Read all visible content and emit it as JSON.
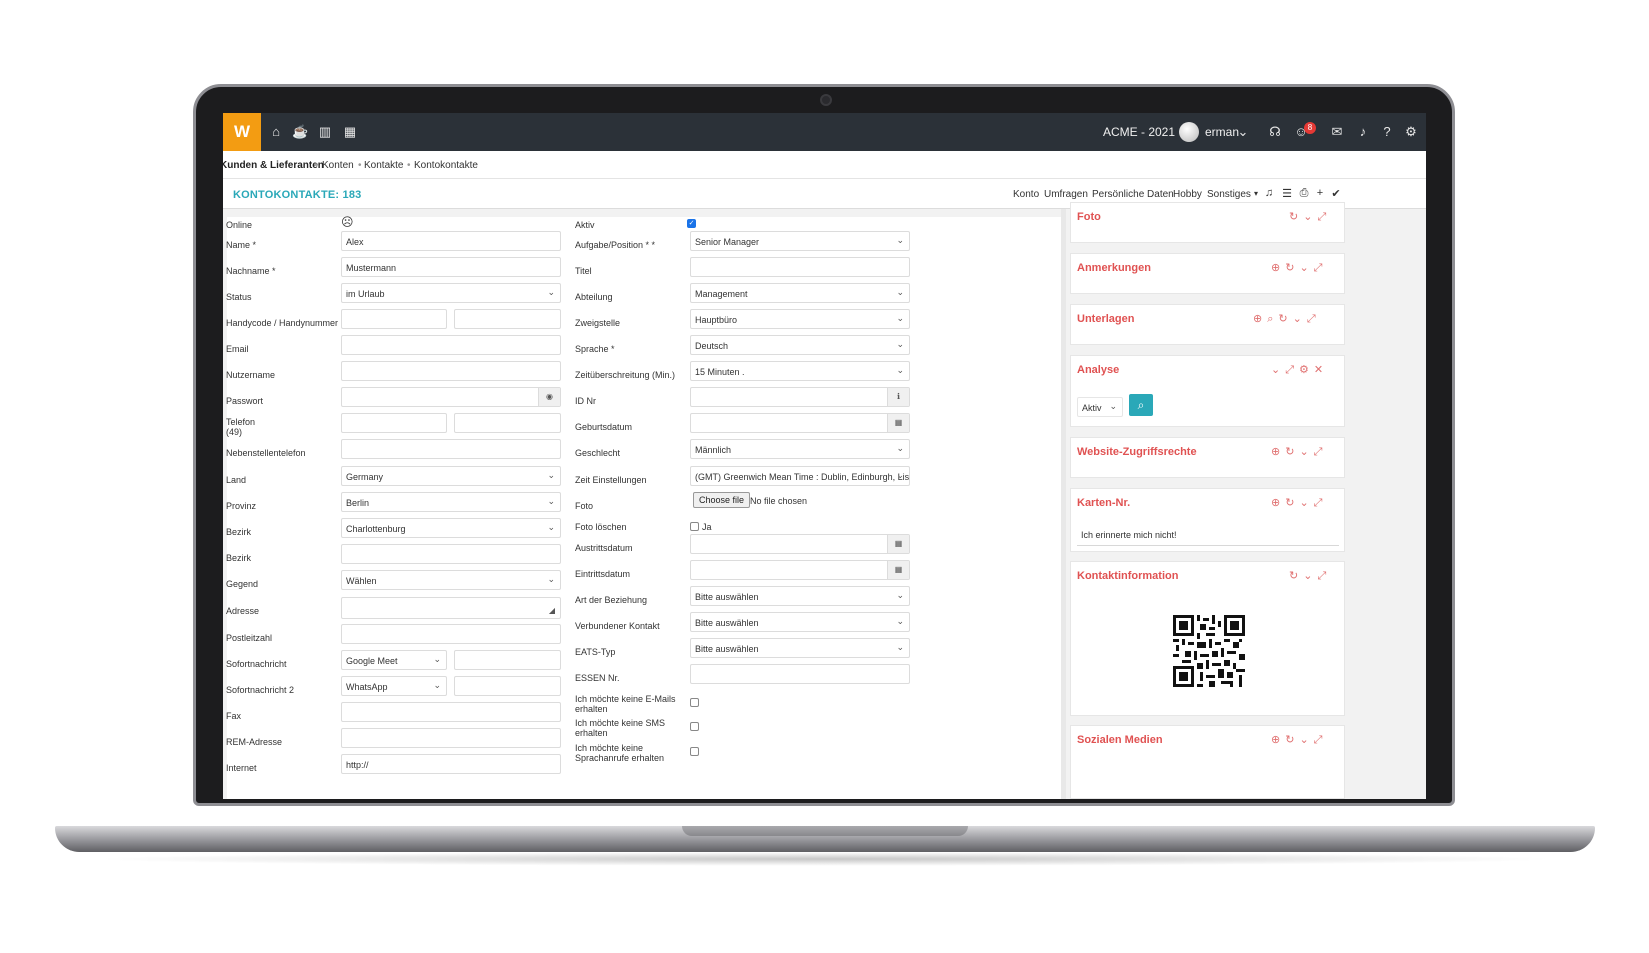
{
  "topbar": {
    "logo": "W",
    "company": "ACME - 2021",
    "user": "erman",
    "notification_count": "8",
    "nav_icons": [
      "home-icon",
      "coffee-icon",
      "chart-icon",
      "calendar-icon"
    ],
    "right_icons": [
      "headset-icon",
      "smile-icon",
      "chat-icon",
      "bell-icon",
      "help-icon",
      "gear-icon"
    ]
  },
  "breadcrumb": [
    "Kunden & Lieferanten",
    "Konten",
    "Kontakte",
    "Kontokontakte"
  ],
  "titlebar": {
    "title": "KONTOKONTAKTE: 183",
    "tabs": [
      "Konto",
      "Umfragen",
      "Persönliche Daten",
      "Hobby",
      "Sonstiges"
    ]
  },
  "form_left": {
    "online_label": "Online",
    "name_label": "Name *",
    "name_value": "Alex",
    "nachname_label": "Nachname *",
    "nachname_value": "Mustermann",
    "status_label": "Status",
    "status_value": "im Urlaub",
    "handy_label": "Handycode / Handynummer",
    "email_label": "Email",
    "nutzername_label": "Nutzername",
    "passwort_label": "Passwort",
    "telefon_label": "Telefon",
    "telefon_code": "(49)",
    "nebenstelle_label": "Nebenstellentelefon",
    "land_label": "Land",
    "land_value": "Germany",
    "provinz_label": "Provinz",
    "provinz_value": "Berlin",
    "bezirk_label": "Bezirk",
    "bezirk_value": "Charlottenburg",
    "bezirk2_label": "Bezirk",
    "gegend_label": "Gegend",
    "gegend_value": "Wählen",
    "adresse_label": "Adresse",
    "plz_label": "Postleitzahl",
    "sofort_label": "Sofortnachricht",
    "sofort_value": "Google Meet",
    "sofort2_label": "Sofortnachricht 2",
    "sofort2_value": "WhatsApp",
    "fax_label": "Fax",
    "rem_label": "REM-Adresse",
    "internet_label": "Internet",
    "internet_value": "http://"
  },
  "form_right": {
    "aktiv_label": "Aktiv",
    "aufgabe_label": "Aufgabe/Position * *",
    "aufgabe_value": "Senior Manager",
    "titel_label": "Titel",
    "abteilung_label": "Abteilung",
    "abteilung_value": "Management",
    "zweigstelle_label": "Zweigstelle",
    "zweigstelle_value": "Hauptbüro",
    "sprache_label": "Sprache *",
    "sprache_value": "Deutsch",
    "zeit_label": "Zeitüberschreitung (Min.)",
    "zeit_value": "15 Minuten .",
    "idnr_label": "ID Nr",
    "geburt_label": "Geburtsdatum",
    "geschlecht_label": "Geschlecht",
    "geschlecht_value": "Männlich",
    "zeiteinst_label": "Zeit Einstellungen",
    "zeiteinst_value": "(GMT) Greenwich Mean Time : Dublin, Edinburgh, Lis",
    "foto_label": "Foto",
    "foto_button": "Choose file",
    "foto_status": "No file chosen",
    "fotoloeschen_label": "Foto löschen",
    "fotoloeschen_ja": "Ja",
    "austritt_label": "Austrittsdatum",
    "eintritt_label": "Eintrittsdatum",
    "beziehung_label": "Art der Beziehung",
    "beziehung_value": "Bitte auswählen",
    "verbunden_label": "Verbundener Kontakt",
    "verbunden_value": "Bitte auswählen",
    "eats_label": "EATS-Typ",
    "eats_value": "Bitte auswählen",
    "essen_label": "ESSEN Nr.",
    "noemail_label_1": "Ich möchte keine E-Mails",
    "noemail_label_2": "erhalten",
    "nosms_label_1": "Ich möchte keine SMS",
    "nosms_label_2": "erhalten",
    "nocall_label_1": "Ich möchte keine",
    "nocall_label_2": "Sprachanrufe erhalten"
  },
  "panels": {
    "foto": "Foto",
    "anmerkungen": "Anmerkungen",
    "unterlagen": "Unterlagen",
    "analyse": "Analyse",
    "analyse_select": "Aktiv",
    "website": "Website-Zugriffsrechte",
    "karten": "Karten-Nr.",
    "karten_text": "Ich erinnerte mich nicht!",
    "kontakt": "Kontaktinformation",
    "sozial": "Sozialen Medien"
  },
  "colors": {
    "accent": "#2aa8b8",
    "panel_title": "#e05252",
    "logo": "#f39c12",
    "topbar": "#2b3138"
  }
}
